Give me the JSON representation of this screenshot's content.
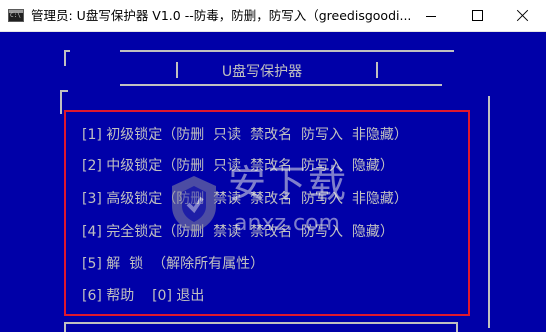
{
  "window": {
    "title": "管理员:  U盘写保护器 V1.0  --防毒，防删，防写入（greedisgoodi...",
    "controls": {
      "minimize": "minimize",
      "maximize": "maximize",
      "close": "close"
    }
  },
  "console": {
    "banner": "U盘写保护器",
    "menu": [
      "[1] 初级锁定（防删  只读  禁改名  防写入  非隐藏）",
      "[2] 中级锁定（防删  只读  禁改名  防写入  隐藏）",
      "[3] 高级锁定（防删  禁读  禁改名  防写入  非隐藏）",
      "[4] 完全锁定（防删  禁读  禁改名  防写入  隐藏）",
      "[5] 解  锁  （解除所有属性）",
      "[6] 帮助    [0] 退出"
    ]
  },
  "watermark": {
    "brand_cn": "安下载",
    "brand_en": "anxz.com"
  },
  "colors": {
    "console_bg": "#0000a8",
    "console_fg": "#c0c0c0",
    "highlight_frame": "#e0182d",
    "titlebar_bg": "#ffffff"
  }
}
